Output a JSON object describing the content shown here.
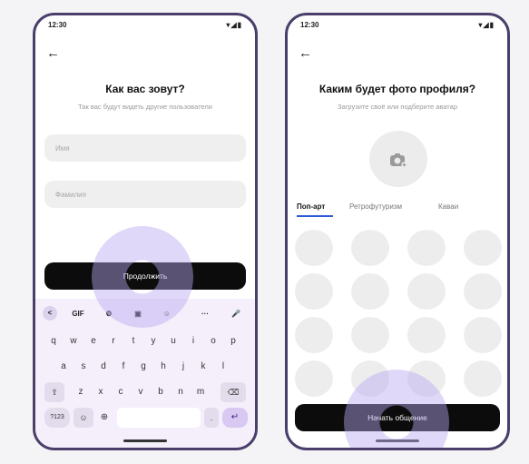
{
  "screen1": {
    "status": {
      "time": "12:30",
      "icons": "▾◢▮"
    },
    "title": "Как вас зовут?",
    "subtitle": "Так вас будут видеть другие пользователи",
    "first_name_placeholder": "Имя",
    "last_name_placeholder": "Фамилия",
    "continue_label": "Продолжить",
    "keyboard": {
      "tools": [
        "<",
        "GIF",
        "⚙",
        "▣",
        "☺",
        "···",
        "🎤"
      ],
      "row1": [
        "q",
        "w",
        "e",
        "r",
        "t",
        "y",
        "u",
        "i",
        "o",
        "p"
      ],
      "row2": [
        "a",
        "s",
        "d",
        "f",
        "g",
        "h",
        "j",
        "k",
        "l"
      ],
      "row3": [
        "⇧",
        "z",
        "x",
        "c",
        "v",
        "b",
        "n",
        "m",
        "⌫"
      ],
      "row4": [
        "?123",
        "☺",
        "⊕",
        "",
        ".",
        "↵"
      ]
    }
  },
  "screen2": {
    "status": {
      "time": "12:30",
      "icons": "▾◢▮"
    },
    "title": "Каким будет фото профиля?",
    "subtitle": "Загрузите своё или подберите аватар",
    "camera_icon": "camera-add-icon",
    "tabs": [
      "Поп-арт",
      "Ретрофутуризм",
      "Каваи"
    ],
    "active_tab": 0,
    "start_label": "Начать общение"
  },
  "colors": {
    "frame": "#4a3f6b",
    "button": "#0c0c0c",
    "ripple": "#b9a8f0",
    "tab_underline": "#2d5bd8",
    "keyboard_bg": "#f4effa",
    "enter_key": "#d8c8f2"
  }
}
